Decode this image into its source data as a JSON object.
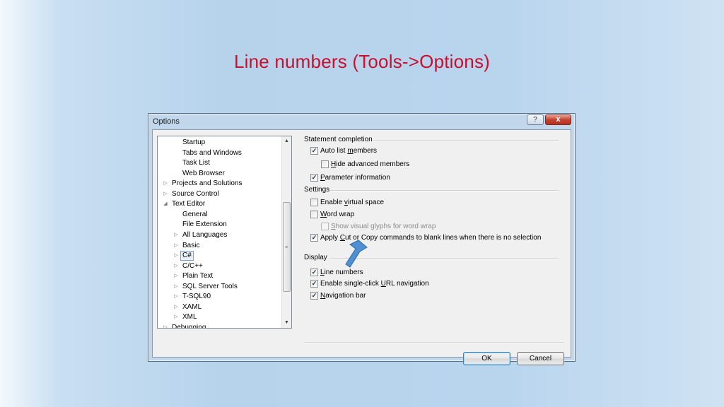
{
  "slide": {
    "title": "Line numbers (Tools->Options)"
  },
  "dialog": {
    "title": "Options",
    "help_label": "?",
    "close_label": "x",
    "tree": [
      {
        "label": "Startup",
        "level": 2,
        "expander": ""
      },
      {
        "label": "Tabs and Windows",
        "level": 2,
        "expander": ""
      },
      {
        "label": "Task List",
        "level": 2,
        "expander": ""
      },
      {
        "label": "Web Browser",
        "level": 2,
        "expander": ""
      },
      {
        "label": "Projects and Solutions",
        "level": 1,
        "expander": "collapsed"
      },
      {
        "label": "Source Control",
        "level": 1,
        "expander": "collapsed"
      },
      {
        "label": "Text Editor",
        "level": 1,
        "expander": "expanded"
      },
      {
        "label": "General",
        "level": 2,
        "expander": ""
      },
      {
        "label": "File Extension",
        "level": 2,
        "expander": ""
      },
      {
        "label": "All Languages",
        "level": 2,
        "expander": "collapsed"
      },
      {
        "label": "Basic",
        "level": 2,
        "expander": "collapsed"
      },
      {
        "label": "C#",
        "level": 2,
        "expander": "collapsed",
        "selected": true
      },
      {
        "label": "C/C++",
        "level": 2,
        "expander": "collapsed"
      },
      {
        "label": "Plain Text",
        "level": 2,
        "expander": "collapsed"
      },
      {
        "label": "SQL Server Tools",
        "level": 2,
        "expander": "collapsed"
      },
      {
        "label": "T-SQL90",
        "level": 2,
        "expander": "collapsed"
      },
      {
        "label": "XAML",
        "level": 2,
        "expander": "collapsed"
      },
      {
        "label": "XML",
        "level": 2,
        "expander": "collapsed"
      },
      {
        "label": "Debugging",
        "level": 1,
        "expander": "collapsed"
      }
    ],
    "groups": {
      "statement_completion": "Statement completion",
      "settings": "Settings",
      "display": "Display"
    },
    "options": {
      "auto_list_members": {
        "pre": "Auto list ",
        "u": "m",
        "post": "embers",
        "checked": true,
        "disabled": false
      },
      "hide_advanced_members": {
        "pre": "",
        "u": "H",
        "post": "ide advanced members",
        "checked": false,
        "disabled": false
      },
      "parameter_information": {
        "pre": "",
        "u": "P",
        "post": "arameter information",
        "checked": true,
        "disabled": false
      },
      "enable_virtual_space": {
        "pre": "Enable ",
        "u": "v",
        "post": "irtual space",
        "checked": false,
        "disabled": false
      },
      "word_wrap": {
        "pre": "",
        "u": "W",
        "post": "ord wrap",
        "checked": false,
        "disabled": false
      },
      "show_visual_glyphs": {
        "pre": "",
        "u": "S",
        "post": "how visual glyphs for word wrap",
        "checked": false,
        "disabled": true
      },
      "apply_cut_copy": {
        "pre": "Apply ",
        "u": "C",
        "post": "ut or Copy commands to blank lines when there is no selection",
        "checked": true,
        "disabled": false
      },
      "line_numbers": {
        "pre": "",
        "u": "L",
        "post": "ine numbers",
        "checked": true,
        "disabled": false
      },
      "single_click_url": {
        "pre": "Enable single-click ",
        "u": "U",
        "post": "RL navigation",
        "checked": true,
        "disabled": false
      },
      "navigation_bar": {
        "pre": "",
        "u": "N",
        "post": "avigation bar",
        "checked": true,
        "disabled": false
      }
    },
    "buttons": {
      "ok": "OK",
      "cancel": "Cancel"
    }
  },
  "colors": {
    "title_red": "#c8102e",
    "arrow_blue": "#4f8fd2"
  },
  "icons": {
    "pointer_arrow": "arrow-icon"
  }
}
